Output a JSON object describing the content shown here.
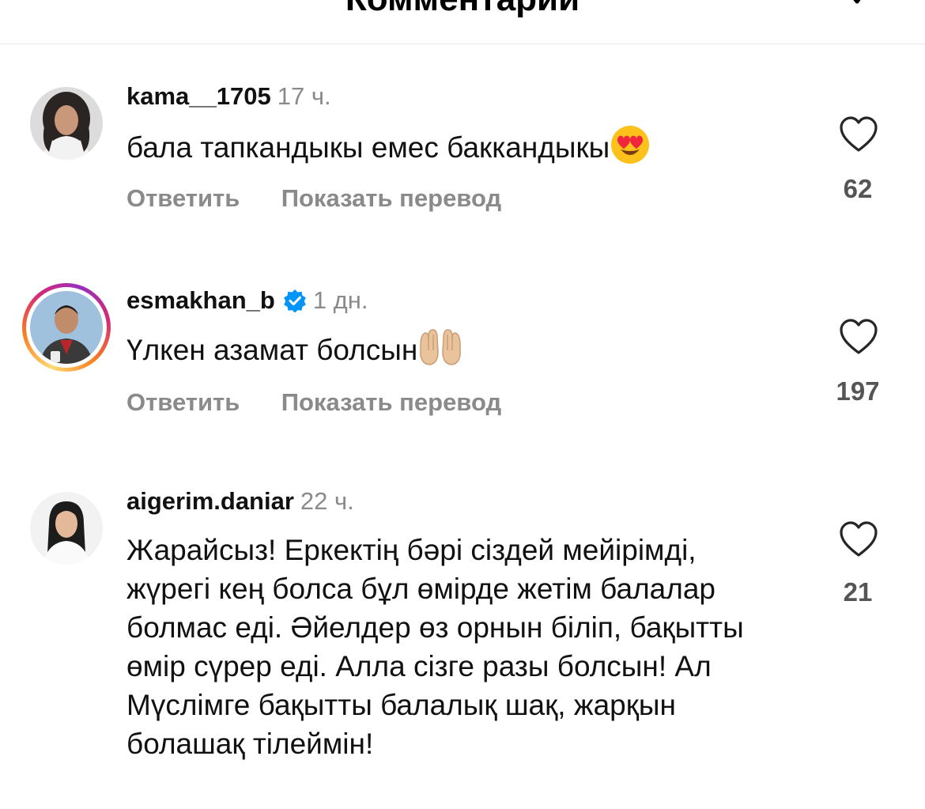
{
  "header": {
    "title": "Комментарии"
  },
  "comments": [
    {
      "username": "kama__1705",
      "time": "17 ч.",
      "text": "бала тапкандыкы емес баккандыкы",
      "emoji": "heart-eyes",
      "reply_label": "Ответить",
      "translate_label": "Показать перевод",
      "likes": "62",
      "verified": false,
      "story_ring": false
    },
    {
      "username": "esmakhan_b",
      "time": "1 дн.",
      "text": "Үлкен азамат болсын",
      "emoji": "palms-up-together",
      "reply_label": "Ответить",
      "translate_label": "Показать перевод",
      "likes": "197",
      "verified": true,
      "story_ring": true
    },
    {
      "username": "aigerim.daniar",
      "time": "22 ч.",
      "text": "Жарайсыз! Еркектің бәрі сіздей мейірімді, жүрегі кең болса бұл өмірде жетім балалар болмас еді. Әйелдер өз орнын біліп, бақытты өмір сүрер еді. Алла  сізге разы болсын! Ал Мүслімге бақытты балалық шақ, жарқын болашақ тілеймін!",
      "likes": "21",
      "verified": false,
      "story_ring": false
    }
  ],
  "colors": {
    "username": "#111111",
    "meta_gray": "#8a8a8a",
    "verified_blue": "#0095f6",
    "like_count": "#555555",
    "divider": "#e8e8e8"
  },
  "icons": {
    "like": "heart-outline-icon",
    "verified": "verified-badge-icon",
    "header_action": "checkmark-icon"
  }
}
